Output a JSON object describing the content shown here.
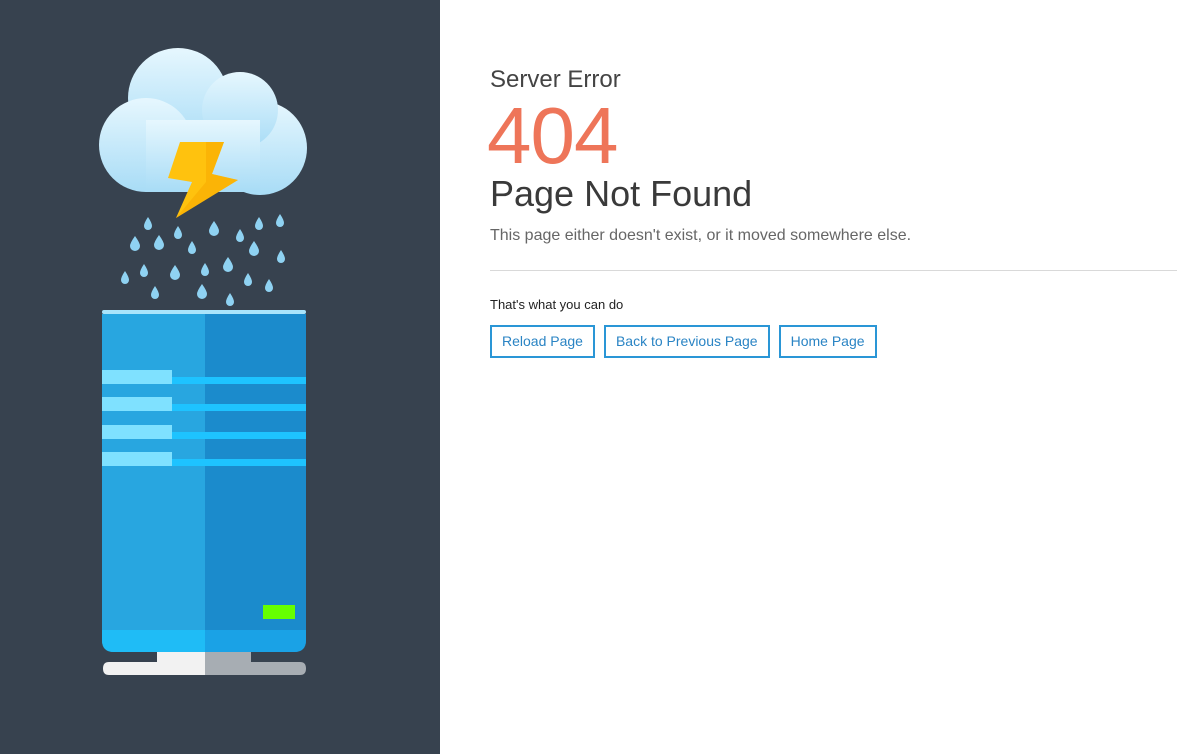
{
  "error": {
    "eyebrow": "Server Error",
    "code": "404",
    "headline": "Page Not Found",
    "description": "This page either doesn't exist, or it moved somewhere else."
  },
  "actions": {
    "label": "That's what you can do",
    "buttons": [
      {
        "label": "Reload Page"
      },
      {
        "label": "Back to Previous Page"
      },
      {
        "label": "Home Page"
      }
    ]
  },
  "illustration": {
    "icons": [
      "cloud-icon",
      "lightning-bolt-icon",
      "raindrops-icon",
      "server-icon",
      "status-light-icon"
    ]
  },
  "colors": {
    "sidebar_background": "#37424f",
    "error_code": "#ee7559",
    "button_border": "#2a96d6",
    "button_text": "#2a84c4",
    "cloud": "#c5ecfc",
    "lightning": "#ffc20e",
    "server_light": "#28a6e0",
    "server_dark": "#1b8bcc",
    "status_light": "#66ff00"
  }
}
